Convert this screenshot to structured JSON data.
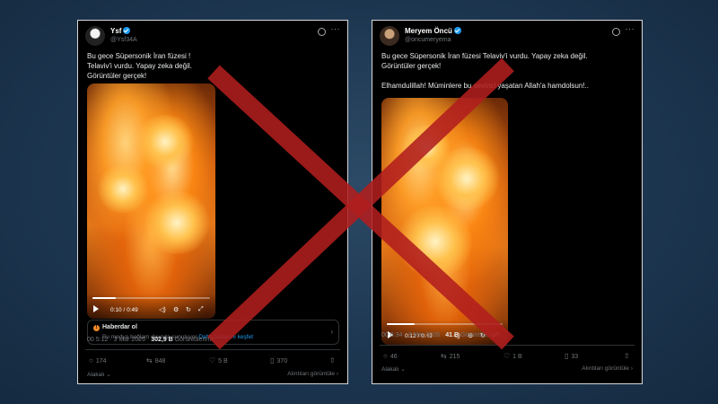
{
  "colors": {
    "background": "#1d3650",
    "card": "#000000",
    "accent": "#1d9bf0",
    "cross": "#b01e1e"
  },
  "left_post": {
    "name": "Ysf",
    "handle": "@Ysf34A",
    "text_lines": [
      "Bu gece Süpersonik İran füzesi !",
      "Telaviv'i vurdu. Yapay zeka değil.",
      "Görüntüler gerçek!"
    ],
    "video_time": "0:10 / 0:49",
    "video_progress": 0.2,
    "notice": {
      "title": "Haberdar ol",
      "body": "Bu medya bağlam dışında sunuluyor",
      "link": "Daha fazlasını keşfet"
    },
    "time": "00 5:12 · 3 Mar 2026 ·",
    "views": "302,9 B",
    "views_label": "Görüntülenme",
    "replies": "174",
    "reposts": "848",
    "likes": "5 B",
    "bookmarks": "370",
    "footer_left": "Alakalı",
    "footer_right": "Alıntıları görüntüle"
  },
  "right_post": {
    "name": "Meryem Öncü",
    "handle": "@oncumeryema",
    "text_lines": [
      "Bu gece Süpersonik İran füzesi Telaviv'i vurdu. Yapay zeka değil.",
      "Görüntüler gerçek!"
    ],
    "text_line2": "Elhamdulillah! Müminlere bu sevinci yaşatan Allah'a hamdolsun!..",
    "video_time": "0:12 / 0:49",
    "video_progress": 0.24,
    "time": "00 6:34 · 3 Mar 2026 ·",
    "views": "41 B",
    "views_label": "Görüntülenme",
    "replies": "46",
    "reposts": "215",
    "likes": "1 B",
    "bookmarks": "33",
    "footer_left": "Alakalı",
    "footer_right": "Alıntıları görüntüle"
  },
  "icons": [
    "grok-icon",
    "more-icon",
    "play-icon",
    "volume-icon",
    "settings-icon",
    "loop-icon",
    "expand-icon",
    "info-icon",
    "reply-icon",
    "repost-icon",
    "like-icon",
    "bookmark-icon",
    "share-icon",
    "cross-mark"
  ]
}
